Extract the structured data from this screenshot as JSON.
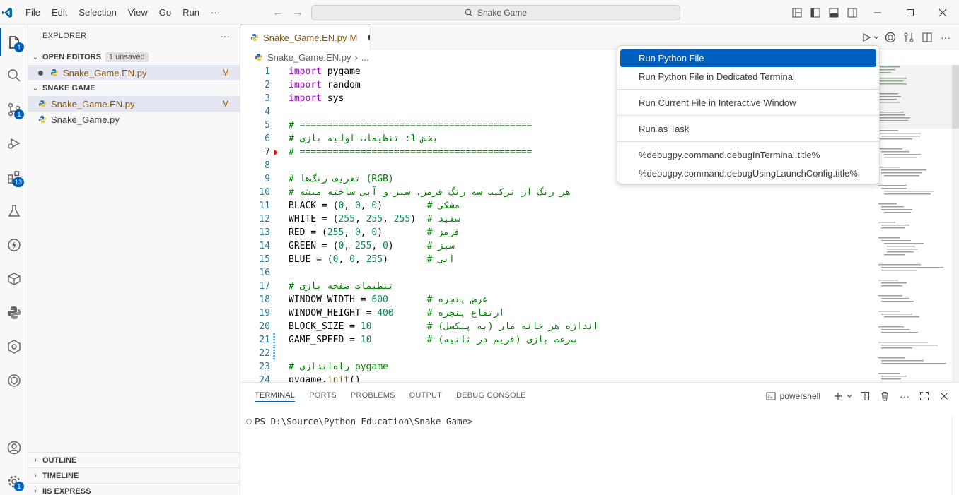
{
  "titlebar": {
    "menu": [
      "File",
      "Edit",
      "Selection",
      "View",
      "Go",
      "Run",
      "···"
    ],
    "search_text": "Snake Game"
  },
  "activity": {
    "badges": {
      "explorer": "1",
      "scm": "1",
      "extensions": "13",
      "settings": "1"
    }
  },
  "sidebar": {
    "title": "EXPLORER",
    "open_editors": {
      "label": "OPEN EDITORS",
      "badge": "1 unsaved",
      "files": [
        {
          "name": "Snake_Game.EN.py",
          "status": "M"
        }
      ]
    },
    "folder": {
      "label": "SNAKE GAME",
      "files": [
        {
          "name": "Snake_Game.EN.py",
          "status": "M"
        },
        {
          "name": "Snake_Game.py",
          "status": ""
        }
      ]
    },
    "bottom_sections": [
      "OUTLINE",
      "TIMELINE",
      "IIS EXPRESS"
    ]
  },
  "editor": {
    "tab": {
      "name": "Snake_Game.EN.py",
      "status": "M"
    },
    "breadcrumb": [
      "Snake_Game.EN.py",
      "..."
    ],
    "line_numbers": [
      "1",
      "2",
      "3",
      "4",
      "5",
      "6",
      "7",
      "8",
      "9",
      "10",
      "11",
      "12",
      "13",
      "14",
      "15",
      "16",
      "17",
      "18",
      "19",
      "20",
      "21",
      "22",
      "23",
      "24"
    ]
  },
  "run_menu": {
    "items": [
      "Run Python File",
      "Run Python File in Dedicated Terminal",
      "Run Current File in Interactive Window",
      "Run as Task",
      "%debugpy.command.debugInTerminal.title%",
      "%debugpy.command.debugUsingLaunchConfig.title%"
    ],
    "active_color": "#0060c0"
  },
  "panel": {
    "tabs": [
      "TERMINAL",
      "PORTS",
      "PROBLEMS",
      "OUTPUT",
      "DEBUG CONSOLE"
    ],
    "shell": "powershell",
    "prompt": "PS D:\\Source\\Python Education\\Snake Game>"
  },
  "colors": {
    "accent": "#005fb8",
    "modified": "#895503",
    "keyword": "#af00db",
    "comment": "#008000",
    "number": "#098658"
  }
}
